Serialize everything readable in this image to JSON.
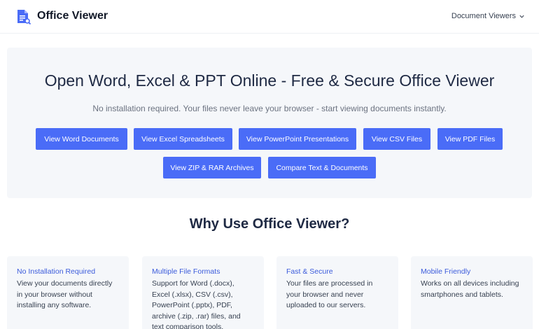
{
  "header": {
    "brand": "Office Viewer",
    "nav_dropdown": "Document Viewers"
  },
  "hero": {
    "title": "Open Word, Excel & PPT Online - Free & Secure Office Viewer",
    "subtitle": "No installation required. Your files never leave your browser - start viewing documents instantly.",
    "buttons": [
      "View Word Documents",
      "View Excel Spreadsheets",
      "View PowerPoint Presentations",
      "View CSV Files",
      "View PDF Files",
      "View ZIP & RAR Archives",
      "Compare Text & Documents"
    ]
  },
  "why": {
    "title": "Why Use Office Viewer?",
    "cards": [
      {
        "title": "No Installation Required",
        "text": "View your documents directly in your browser without installing any software."
      },
      {
        "title": "Multiple File Formats",
        "text": "Support for Word (.docx), Excel (.xlsx), CSV (.csv), PowerPoint (.pptx), PDF, archive (.zip, .rar) files, and text comparison tools."
      },
      {
        "title": "Fast & Secure",
        "text": "Your files are processed in your browser and never uploaded to our servers."
      },
      {
        "title": "Mobile Friendly",
        "text": "Works on all devices including smartphones and tablets."
      }
    ]
  },
  "colors": {
    "accent": "#4a6cf7",
    "hero_bg": "#f5f7fa",
    "card_title": "#3b5bdb"
  },
  "icons": {
    "logo": "document-search-icon",
    "dropdown": "chevron-down-icon"
  }
}
